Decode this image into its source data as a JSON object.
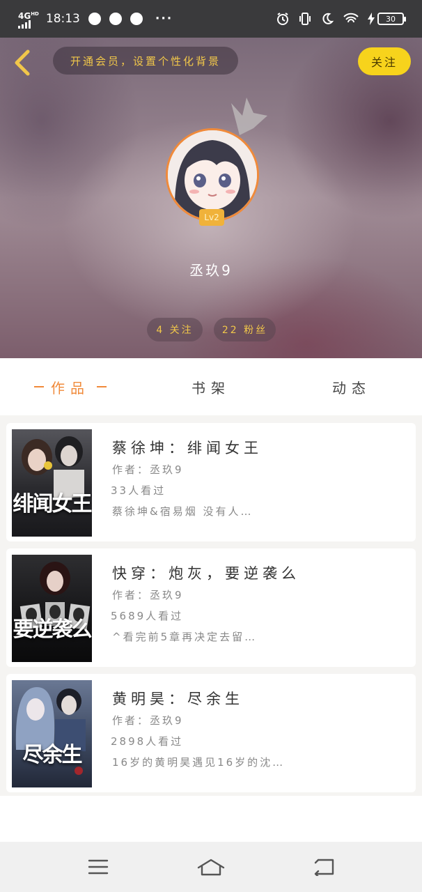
{
  "status_bar": {
    "network": "4G",
    "network_sup": "HD",
    "time": "18:13",
    "dots": "···",
    "battery": "30"
  },
  "header": {
    "vip_banner": "开通会员，设置个性化背景",
    "follow_label": "关注",
    "level": "Lv2",
    "username": "丞玖9",
    "following": "4 关注",
    "fans": "22 粉丝"
  },
  "tabs": {
    "works": "作品",
    "bookshelf": "书架",
    "activity": "动态"
  },
  "books": [
    {
      "title": "蔡徐坤：绯闻女王",
      "author": "作者：丞玖9",
      "views": "33人看过",
      "desc": "蔡徐坤&宿易烟 没有人…",
      "cover_text": "绯闻女王",
      "cover_colors": [
        "#4a4a4f",
        "#1c1c1f"
      ]
    },
    {
      "title": "快穿：炮灰，要逆袭么",
      "author": "作者：丞玖9",
      "views": "5689人看过",
      "desc": "^看完前5章再决定去留…",
      "cover_text": "要逆袭么",
      "cover_colors": [
        "#2b2b2e",
        "#0c0c0e"
      ]
    },
    {
      "title": "黄明昊：尽余生",
      "author": "作者：丞玖9",
      "views": "2898人看过",
      "desc": "16岁的黄明昊遇见16岁的沈…",
      "cover_text": "尽余生",
      "cover_colors": [
        "#5a6a86",
        "#2a3246"
      ]
    }
  ],
  "colors": {
    "accent": "#f08a3a",
    "follow_bg": "#f7d31c",
    "gold_text": "#f1c74a"
  },
  "icons": {
    "back": "chevron-left-icon",
    "menu": "menu-icon",
    "home": "home-icon",
    "return": "return-icon"
  }
}
